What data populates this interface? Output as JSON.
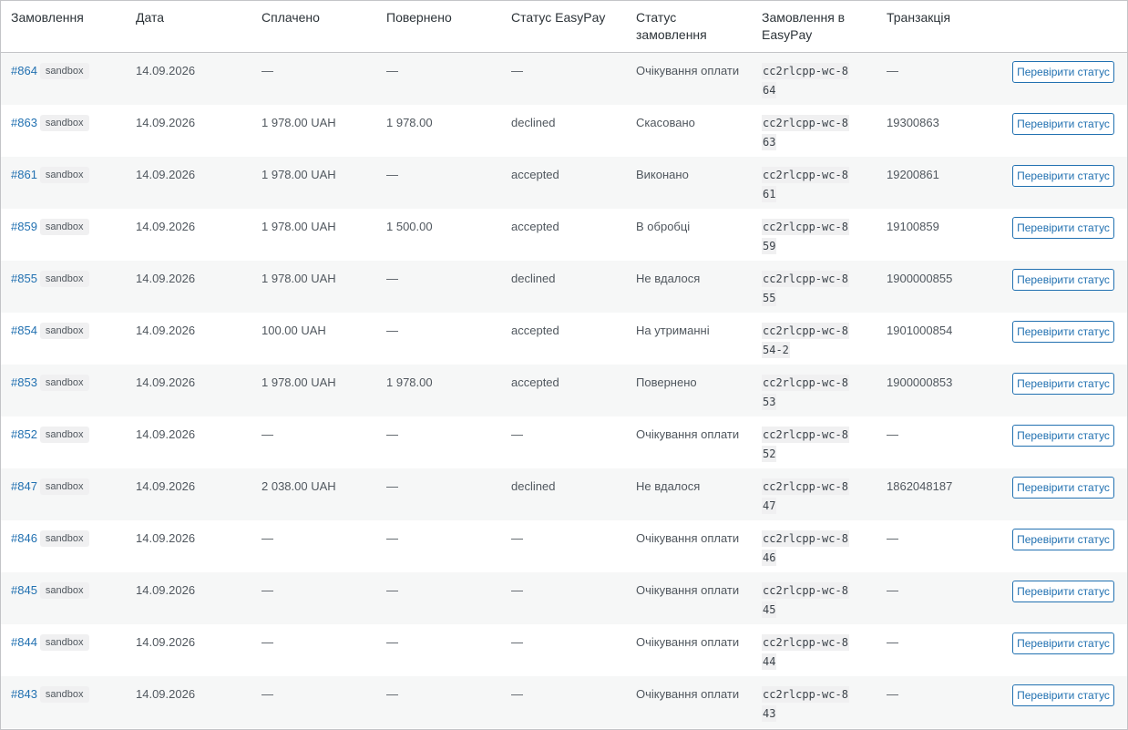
{
  "table": {
    "headers": {
      "order": "Замовлення",
      "date": "Дата",
      "paid": "Сплачено",
      "refunded": "Повернено",
      "easypay_status": "Статус EasyPay",
      "order_status": "Статус замовлення",
      "easypay_order": "Замовлення в EasyPay",
      "transaction": "Транзакція"
    },
    "button_label": "Перевірити статус",
    "badge_label": "sandbox",
    "colors": {
      "link": "#2271b1",
      "border": "#c3c4c7",
      "stripe": "#f6f7f7"
    },
    "rows": [
      {
        "order": "#864",
        "date": "14.09.2026",
        "paid": "—",
        "refunded": "—",
        "easypay_status": "—",
        "order_status": "Очікування оплати",
        "easypay_order": "cc2rlcpp-wc-864",
        "transaction": "—"
      },
      {
        "order": "#863",
        "date": "14.09.2026",
        "paid": "1 978.00 UAH",
        "refunded": "1 978.00",
        "easypay_status": "declined",
        "order_status": "Скасовано",
        "easypay_order": "cc2rlcpp-wc-863",
        "transaction": "19300863"
      },
      {
        "order": "#861",
        "date": "14.09.2026",
        "paid": "1 978.00 UAH",
        "refunded": "—",
        "easypay_status": "accepted",
        "order_status": "Виконано",
        "easypay_order": "cc2rlcpp-wc-861",
        "transaction": "19200861"
      },
      {
        "order": "#859",
        "date": "14.09.2026",
        "paid": "1 978.00 UAH",
        "refunded": "1 500.00",
        "easypay_status": "accepted",
        "order_status": "В обробці",
        "easypay_order": "cc2rlcpp-wc-859",
        "transaction": "19100859"
      },
      {
        "order": "#855",
        "date": "14.09.2026",
        "paid": "1 978.00 UAH",
        "refunded": "—",
        "easypay_status": "declined",
        "order_status": "Не вдалося",
        "easypay_order": "cc2rlcpp-wc-855",
        "transaction": "1900000855"
      },
      {
        "order": "#854",
        "date": "14.09.2026",
        "paid": "100.00 UAH",
        "refunded": "—",
        "easypay_status": "accepted",
        "order_status": "На утриманні",
        "easypay_order": "cc2rlcpp-wc-854-2",
        "transaction": "1901000854"
      },
      {
        "order": "#853",
        "date": "14.09.2026",
        "paid": "1 978.00 UAH",
        "refunded": "1 978.00",
        "easypay_status": "accepted",
        "order_status": "Повернено",
        "easypay_order": "cc2rlcpp-wc-853",
        "transaction": "1900000853"
      },
      {
        "order": "#852",
        "date": "14.09.2026",
        "paid": "—",
        "refunded": "—",
        "easypay_status": "—",
        "order_status": "Очікування оплати",
        "easypay_order": "cc2rlcpp-wc-852",
        "transaction": "—"
      },
      {
        "order": "#847",
        "date": "14.09.2026",
        "paid": "2 038.00 UAH",
        "refunded": "—",
        "easypay_status": "declined",
        "order_status": "Не вдалося",
        "easypay_order": "cc2rlcpp-wc-847",
        "transaction": "1862048187"
      },
      {
        "order": "#846",
        "date": "14.09.2026",
        "paid": "—",
        "refunded": "—",
        "easypay_status": "—",
        "order_status": "Очікування оплати",
        "easypay_order": "cc2rlcpp-wc-846",
        "transaction": "—"
      },
      {
        "order": "#845",
        "date": "14.09.2026",
        "paid": "—",
        "refunded": "—",
        "easypay_status": "—",
        "order_status": "Очікування оплати",
        "easypay_order": "cc2rlcpp-wc-845",
        "transaction": "—"
      },
      {
        "order": "#844",
        "date": "14.09.2026",
        "paid": "—",
        "refunded": "—",
        "easypay_status": "—",
        "order_status": "Очікування оплати",
        "easypay_order": "cc2rlcpp-wc-844",
        "transaction": "—"
      },
      {
        "order": "#843",
        "date": "14.09.2026",
        "paid": "—",
        "refunded": "—",
        "easypay_status": "—",
        "order_status": "Очікування оплати",
        "easypay_order": "cc2rlcpp-wc-843",
        "transaction": "—"
      }
    ]
  }
}
